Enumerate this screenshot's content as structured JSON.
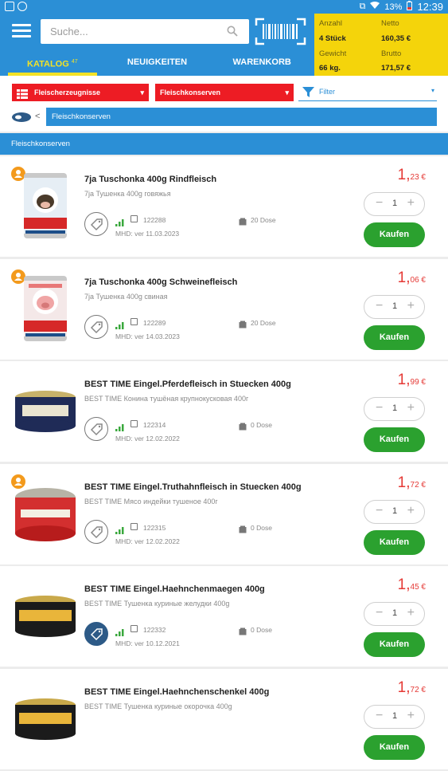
{
  "status": {
    "battery": "13%",
    "time": "12:39"
  },
  "search": {
    "placeholder": "Suche..."
  },
  "tabs": [
    {
      "label": "KATALOG",
      "badge": "47",
      "active": true
    },
    {
      "label": "NEUIGKEITEN",
      "active": false
    },
    {
      "label": "WARENKORB",
      "active": false
    }
  ],
  "summary": {
    "anzahl_label": "Anzahl",
    "anzahl_value": "4 Stück",
    "netto_label": "Netto",
    "netto_value": "160,35 €",
    "gewicht_label": "Gewicht",
    "gewicht_value": "66 kg.",
    "brutto_label": "Brutto",
    "brutto_value": "171,57 €"
  },
  "filters": {
    "category": "Fleischerzeugnisse",
    "subcategory": "Fleischkonserven",
    "filter_label": "Filter"
  },
  "breadcrumb": {
    "back": "<",
    "current": "Fleischkonserven"
  },
  "section": {
    "title": "Fleischkonserven"
  },
  "colors": {
    "primary": "#2b8fd6",
    "accent": "#f4d40b",
    "buy": "#2ba12f",
    "price": "#e53935",
    "filter_red": "#ed1c24"
  },
  "products": [
    {
      "name": "7ja Tuschonka 400g Rindfleisch",
      "subname": "7ja Тушенка 400g говяжья",
      "sku": "122288",
      "pack": "20 Dose",
      "mhd": "MHD: ver 11.03.2023",
      "price_int": "1,",
      "price_dec": "23 €",
      "qty": "1",
      "buy": "Kaufen",
      "user_badge": true,
      "tag_filled": false,
      "img": "cow"
    },
    {
      "name": "7ja Tuschonka 400g Schweinefleisch",
      "subname": "7ja Тушенка 400g свиная",
      "sku": "122289",
      "pack": "20 Dose",
      "mhd": "MHD: ver 14.03.2023",
      "price_int": "1,",
      "price_dec": "06 €",
      "qty": "1",
      "buy": "Kaufen",
      "user_badge": true,
      "tag_filled": false,
      "img": "pig"
    },
    {
      "name": "BEST TIME Eingel.Pferdefleisch in Stuecken 400g",
      "subname": "BEST TIME Конина тушёная крупнокусковая 400г",
      "sku": "122314",
      "pack": "0 Dose",
      "mhd": "MHD: ver 12.02.2022",
      "price_int": "1,",
      "price_dec": "99 €",
      "qty": "1",
      "buy": "Kaufen",
      "user_badge": false,
      "tag_filled": false,
      "img": "tin-blue"
    },
    {
      "name": "BEST TIME Eingel.Truthahnfleisch in Stuecken 400g",
      "subname": "BEST TIME Мясо индейки тушеное 400г",
      "sku": "122315",
      "pack": "0 Dose",
      "mhd": "MHD: ver 12.02.2022",
      "price_int": "1,",
      "price_dec": "72 €",
      "qty": "1",
      "buy": "Kaufen",
      "user_badge": true,
      "tag_filled": false,
      "img": "tin-red"
    },
    {
      "name": "BEST TIME Eingel.Haehnchenmaegen 400g",
      "subname": "BEST TIME Тушенка куриные желудки  400g",
      "sku": "122332",
      "pack": "0 Dose",
      "mhd": "MHD: ver 10.12.2021",
      "price_int": "1,",
      "price_dec": "45 €",
      "qty": "1",
      "buy": "Kaufen",
      "user_badge": false,
      "tag_filled": true,
      "img": "tin-gold"
    },
    {
      "name": "BEST TIME Eingel.Haehnchenschenkel 400g",
      "subname": "BEST TIME Тушенка куриные окорочка 400g",
      "sku": "",
      "pack": "",
      "mhd": "",
      "price_int": "1,",
      "price_dec": "72 €",
      "qty": "1",
      "buy": "Kaufen",
      "user_badge": false,
      "tag_filled": false,
      "img": "tin-gold"
    }
  ]
}
